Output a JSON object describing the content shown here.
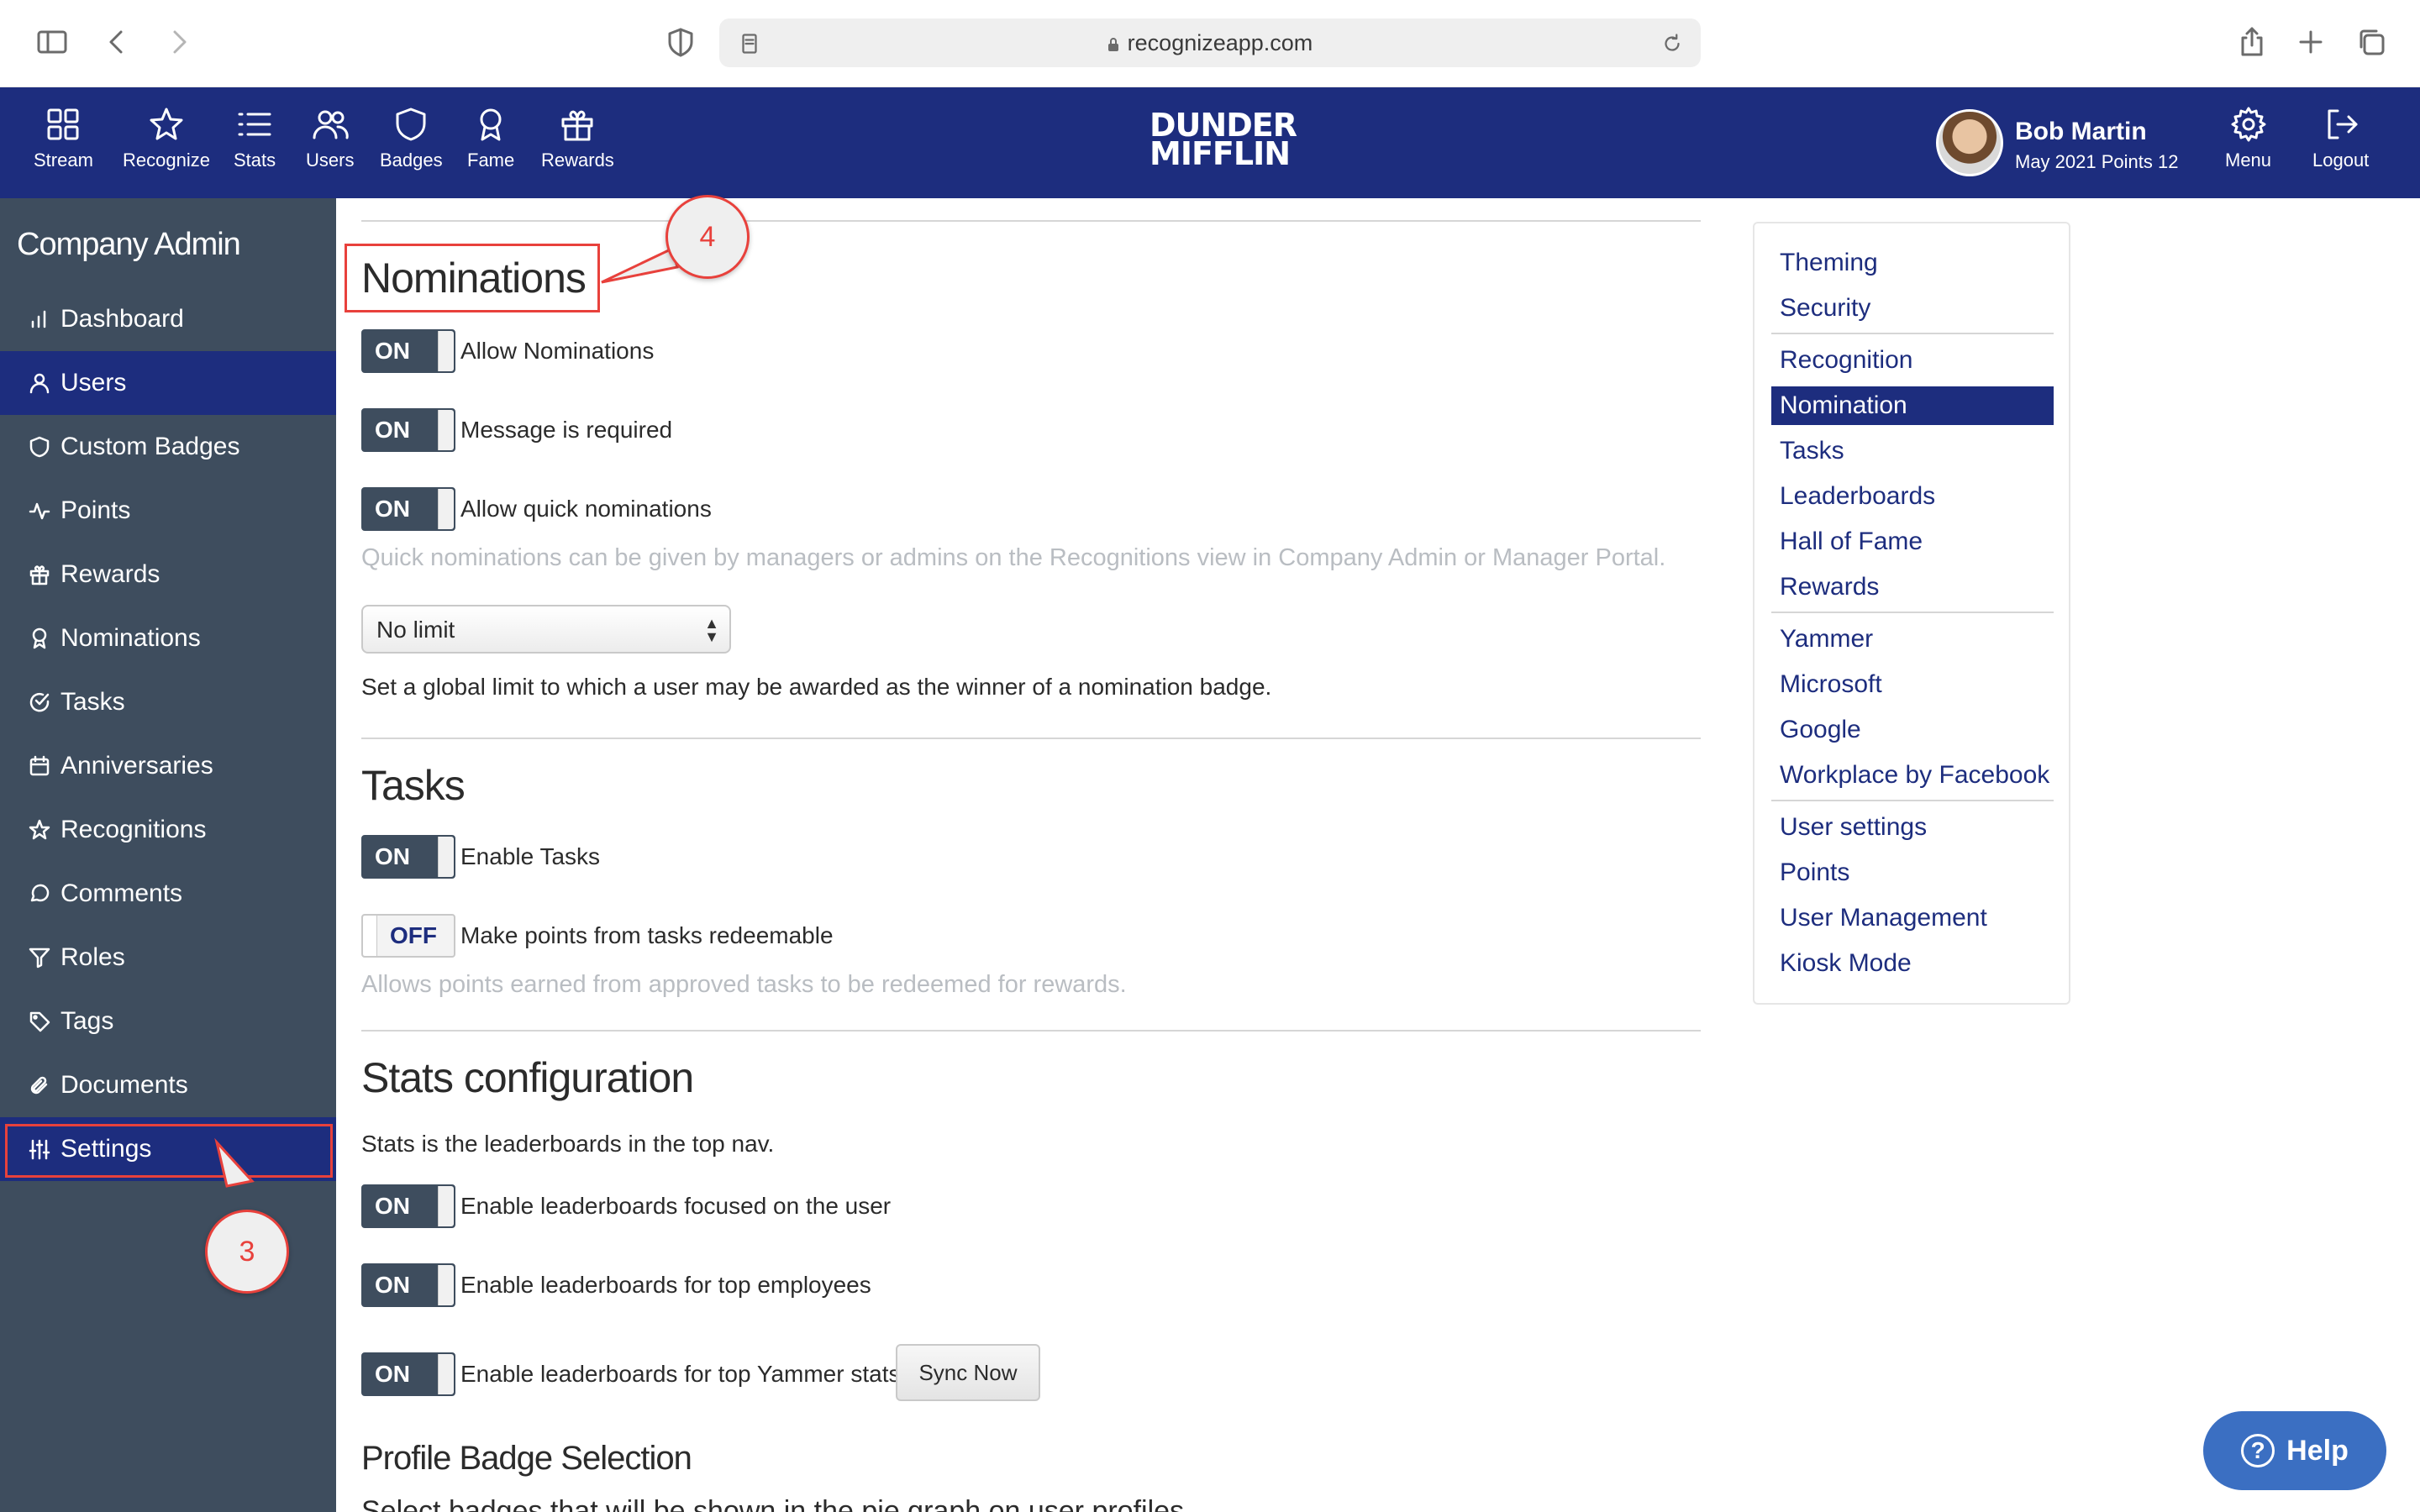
{
  "browser": {
    "url": "recognizeapp.com"
  },
  "topnav": {
    "items": [
      {
        "label": "Stream",
        "icon": "grid-icon"
      },
      {
        "label": "Recognize",
        "icon": "star-icon"
      },
      {
        "label": "Stats",
        "icon": "list-icon"
      },
      {
        "label": "Users",
        "icon": "users-icon"
      },
      {
        "label": "Badges",
        "icon": "shield-icon"
      },
      {
        "label": "Fame",
        "icon": "award-icon"
      },
      {
        "label": "Rewards",
        "icon": "gift-icon"
      }
    ],
    "logo_line1": "DUNDER",
    "logo_line2": "MIFFLIN",
    "user_name": "Bob Martin",
    "user_points": "May 2021 Points 12",
    "menu_label": "Menu",
    "logout_label": "Logout"
  },
  "sidebar": {
    "title": "Company Admin",
    "items": [
      {
        "label": "Dashboard",
        "icon": "bar-chart-icon"
      },
      {
        "label": "Users",
        "icon": "user-icon"
      },
      {
        "label": "Custom Badges",
        "icon": "shield-icon"
      },
      {
        "label": "Points",
        "icon": "activity-icon"
      },
      {
        "label": "Rewards",
        "icon": "gift-icon"
      },
      {
        "label": "Nominations",
        "icon": "award-icon"
      },
      {
        "label": "Tasks",
        "icon": "check-circle-icon"
      },
      {
        "label": "Anniversaries",
        "icon": "calendar-icon"
      },
      {
        "label": "Recognitions",
        "icon": "star-icon"
      },
      {
        "label": "Comments",
        "icon": "comment-icon"
      },
      {
        "label": "Roles",
        "icon": "filter-icon"
      },
      {
        "label": "Tags",
        "icon": "tag-icon"
      },
      {
        "label": "Documents",
        "icon": "paperclip-icon"
      },
      {
        "label": "Settings",
        "icon": "sliders-icon"
      }
    ]
  },
  "main": {
    "nominations": {
      "title": "Nominations",
      "allow_toggle": "ON",
      "allow_label": "Allow Nominations",
      "message_toggle": "ON",
      "message_label": "Message is required",
      "quick_toggle": "ON",
      "quick_label": "Allow quick nominations",
      "quick_help": "Quick nominations can be given by managers or admins on the Recognitions view in Company Admin or Manager Portal.",
      "limit_select": "No limit",
      "limit_help": "Set a global limit to which a user may be awarded as the winner of a nomination badge."
    },
    "tasks": {
      "title": "Tasks",
      "enable_toggle": "ON",
      "enable_label": "Enable Tasks",
      "redeem_toggle": "OFF",
      "redeem_label": "Make points from tasks redeemable",
      "redeem_help": "Allows points earned from approved tasks to be redeemed for rewards."
    },
    "stats": {
      "title": "Stats configuration",
      "desc": "Stats is the leaderboards in the top nav.",
      "user_toggle": "ON",
      "user_label": "Enable leaderboards focused on the user",
      "top_toggle": "ON",
      "top_label": "Enable leaderboards for top employees",
      "yammer_toggle": "ON",
      "yammer_label": "Enable leaderboards for top Yammer stats",
      "sync_button": "Sync Now"
    },
    "profile": {
      "title": "Profile Badge Selection",
      "desc": "Select badges that will be shown in the pie graph on user profiles."
    }
  },
  "settings_nav": {
    "items": [
      "Theming",
      "Security",
      "Recognition",
      "Nomination",
      "Tasks",
      "Leaderboards",
      "Hall of Fame",
      "Rewards",
      "Yammer",
      "Microsoft",
      "Google",
      "Workplace by Facebook",
      "User settings",
      "Points",
      "User Management",
      "Kiosk Mode"
    ],
    "active": "Nomination"
  },
  "callouts": {
    "nominations_step": "4",
    "settings_step": "3"
  },
  "help_button": "Help",
  "colors": {
    "brand_navy": "#1d2d7e",
    "sidebar_slate": "#3e4d5e",
    "annotation_red": "#e8413c",
    "help_blue": "#3b6fc2"
  }
}
